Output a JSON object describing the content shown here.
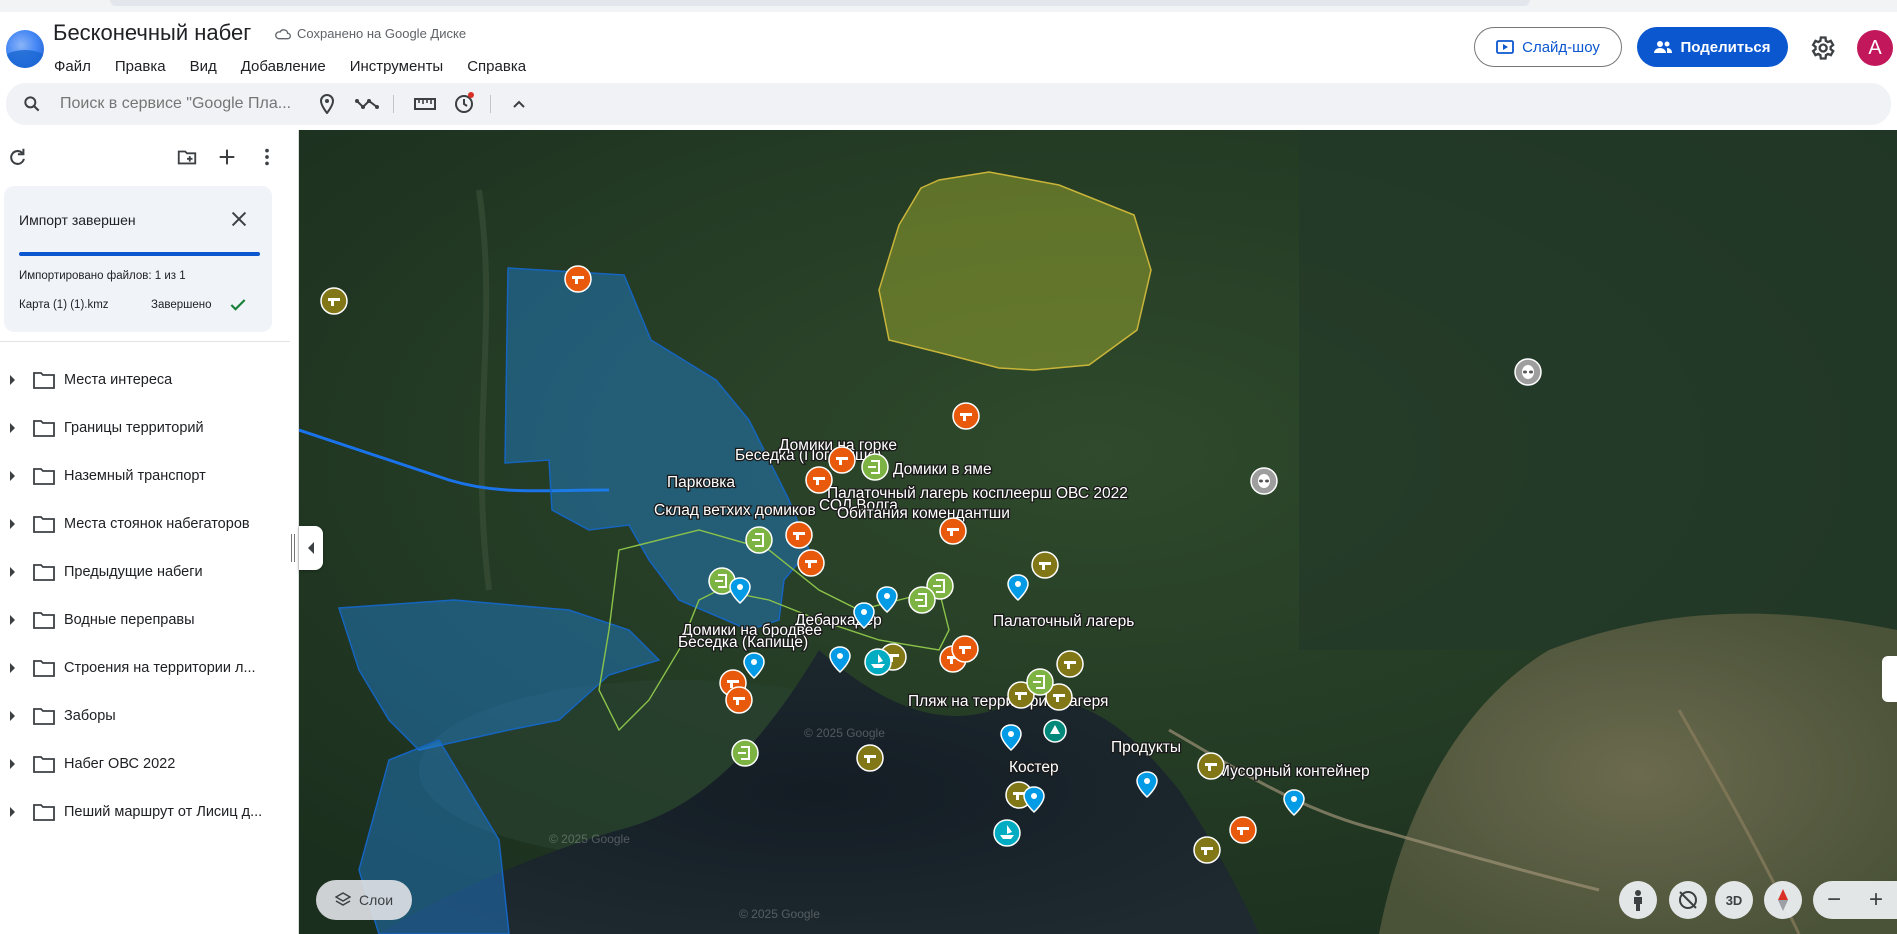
{
  "app": {
    "title": "Бесконечный набег",
    "save_status": "Сохранено на Google Диске",
    "avatar_letter": "A"
  },
  "menu": [
    "Файл",
    "Правка",
    "Вид",
    "Добавление",
    "Инструменты",
    "Справка"
  ],
  "header_buttons": {
    "slideshow": "Слайд-шоу",
    "share": "Поделиться"
  },
  "search": {
    "placeholder": "Поиск в сервисе \"Google Пла..."
  },
  "import": {
    "title": "Импорт завершен",
    "count": "Импортировано файлов: 1 из 1",
    "file": "Карта (1) (1).kmz",
    "status": "Завершено"
  },
  "folders": [
    "Места интереса",
    "Границы территорий",
    "Наземный транспорт",
    "Места стоянок набегаторов",
    "Предыдущие набеги",
    "Водные переправы",
    "Строения на территории л...",
    "Заборы",
    "Набег ОВС 2022",
    "Пеший маршрут от Лисиц д..."
  ],
  "map_labels": {
    "l1": "Беседка (Поганище)",
    "l2": "Домики на горке",
    "l3": "Домики в яме",
    "l4": "Парковка",
    "l5": "Палаточный лагерь косплеерш ОВС 2022",
    "l6": "Склад ветхих домиков",
    "l7": "СОЛ Волга",
    "l8": "Обитания комендантши",
    "l9": "Дебаркадер",
    "l10": "Палаточный лагерь",
    "l11": "Домики на бродвее",
    "l12": "Беседка (Капище)",
    "l13": "Пляж на территории лагеря",
    "l14": "Продукты",
    "l15": "Костер",
    "l16": "Мусорный контейнер",
    "w1": "© 2025 Google",
    "w2": "© 2025 Google",
    "w3": "© 2025 Google"
  },
  "map_controls": {
    "layers": "Слои",
    "three_d": "3D"
  },
  "colors": {
    "accent": "#0b57d0",
    "marker_orange": "#e8590c",
    "marker_green": "#7cb342",
    "marker_olive": "#827717",
    "marker_blue": "#039be5",
    "marker_teal": "#00acc1",
    "polygon_blue": "#1e88e5",
    "polygon_yellow": "#c0ca33"
  }
}
